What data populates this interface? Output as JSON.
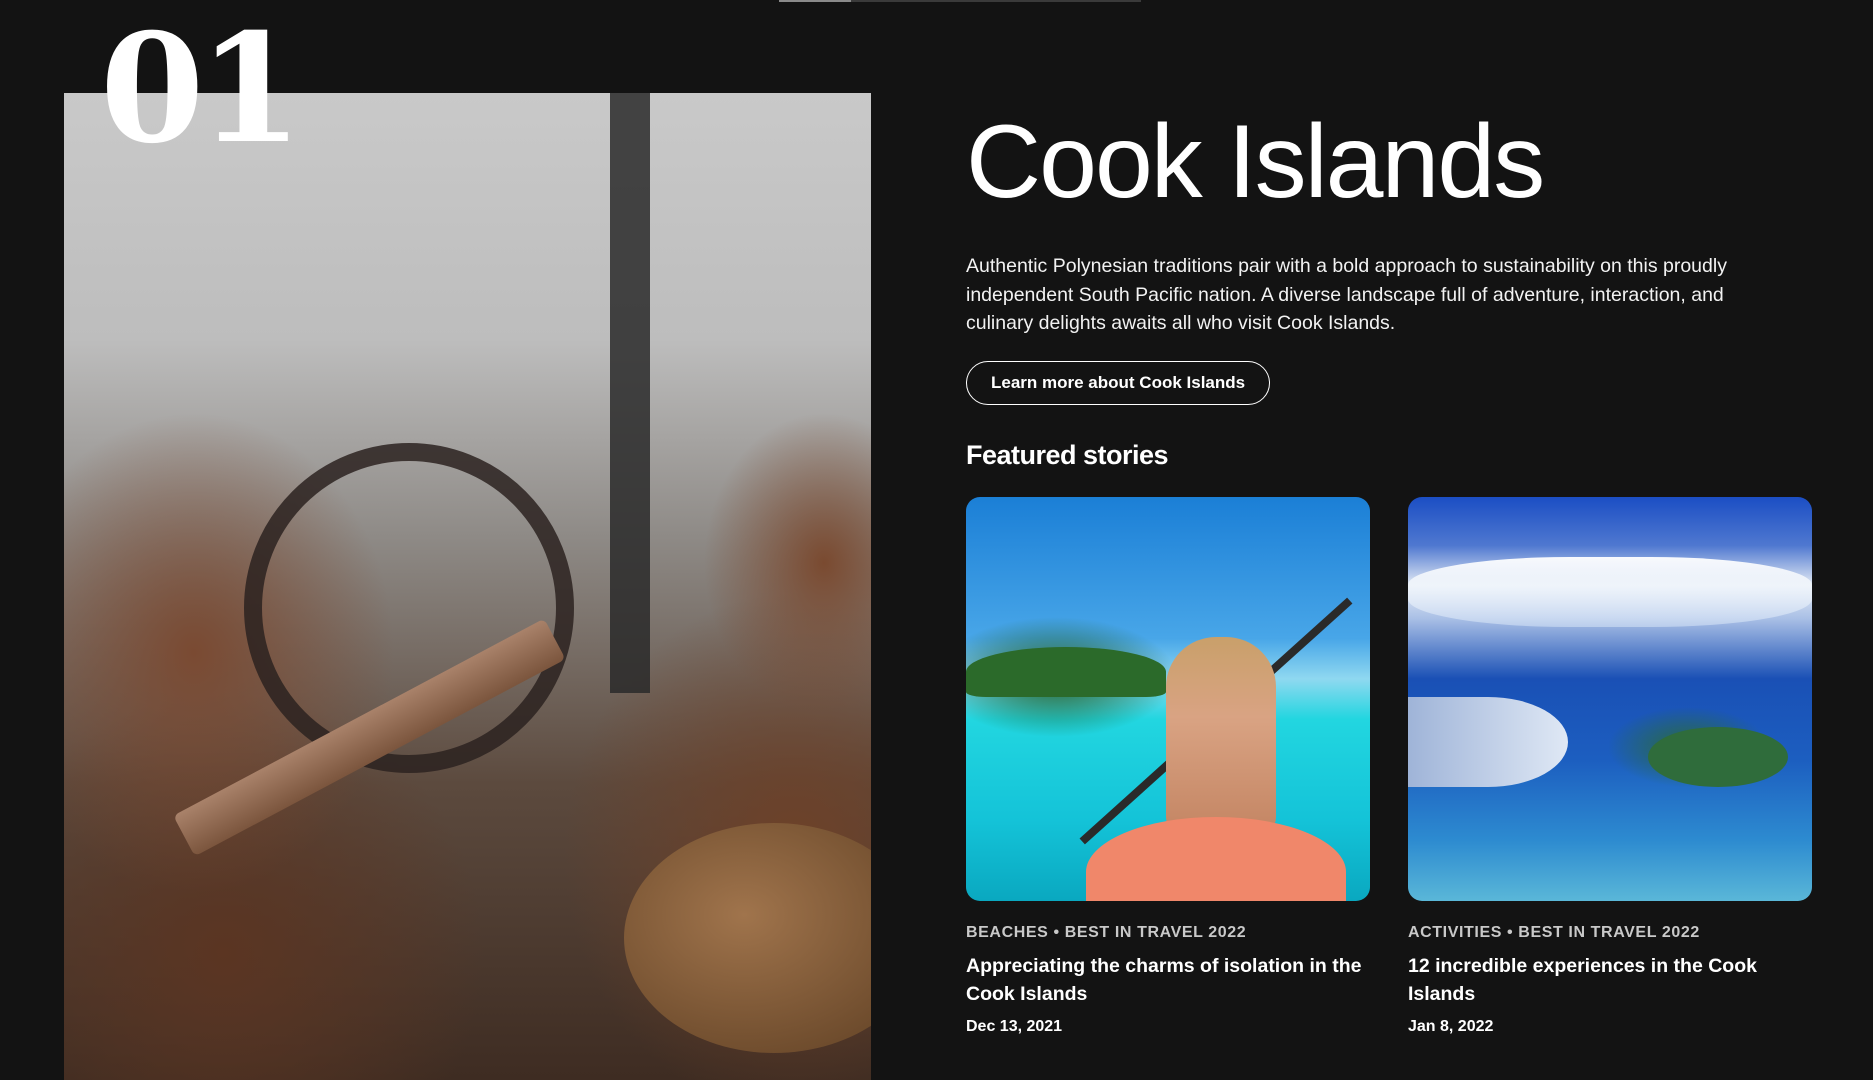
{
  "progress": {
    "fraction": 0.2
  },
  "hero": {
    "number": "01"
  },
  "destination": {
    "title": "Cook Islands",
    "description": "Authentic Polynesian traditions pair with a bold approach to sustainability on this proudly independent South Pacific nation. A diverse landscape full of adventure, interaction, and culinary delights awaits all who visit Cook Islands.",
    "cta_label": "Learn more about Cook Islands"
  },
  "featured": {
    "heading": "Featured stories",
    "stories": [
      {
        "category": "BEACHES • BEST IN TRAVEL 2022",
        "title": "Appreciating the charms of isolation in the Cook Islands",
        "date": "Dec 13, 2021"
      },
      {
        "category": "ACTIVITIES • BEST IN TRAVEL 2022",
        "title": "12 incredible experiences in the Cook Islands",
        "date": "Jan 8, 2022"
      }
    ]
  },
  "colors": {
    "background": "#131313",
    "text": "#ffffff",
    "muted": "#c9c9c9"
  }
}
